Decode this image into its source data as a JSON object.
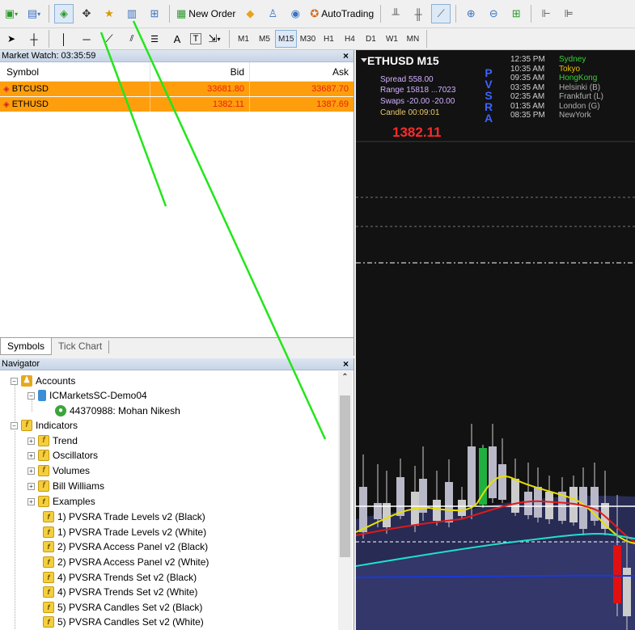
{
  "toolbar": {
    "new_order": "New Order",
    "auto_trading": "AutoTrading",
    "timeframes": [
      "M1",
      "M5",
      "M15",
      "M30",
      "H1",
      "H4",
      "D1",
      "W1",
      "MN"
    ],
    "active_timeframe": "M15",
    "text_tool": "A"
  },
  "market_watch": {
    "title": "Market Watch: 03:35:59",
    "close": "×",
    "col_symbol": "Symbol",
    "col_bid": "Bid",
    "col_ask": "Ask",
    "rows": [
      {
        "symbol": "BTCUSD",
        "bid": "33681.80",
        "ask": "33687.70"
      },
      {
        "symbol": "ETHUSD",
        "bid": "1382.11",
        "ask": "1387.69"
      }
    ],
    "tab_symbols": "Symbols",
    "tab_tick": "Tick Chart"
  },
  "navigator": {
    "title": "Navigator",
    "close": "×",
    "accounts": "Accounts",
    "server": "ICMarketsSC-Demo04",
    "account": "44370988: Mohan Nikesh",
    "indicators": "Indicators",
    "folders": [
      "Trend",
      "Oscillators",
      "Volumes",
      "Bill Williams",
      "Examples"
    ],
    "items": [
      "1) PVSRA Trade Levels v2 (Black)",
      "1) PVSRA Trade Levels v2 (White)",
      "2) PVSRA Access Panel v2 (Black)",
      "2) PVSRA Access Panel v2 (White)",
      "4) PVSRA Trends Set v2 (Black)",
      "4) PVSRA Trends Set v2 (White)",
      "5) PVSRA Candles Set v2 (Black)",
      "5) PVSRA Candles Set v2 (White)"
    ]
  },
  "chart": {
    "title": "ETHUSD  M15",
    "spread": "Spread 558.00",
    "range": "Range  15818  ...7023",
    "swaps": "Swaps  -20.00  -20.00",
    "candle": "Candle  00:09:01",
    "price": "1382.11",
    "pvsra": [
      "P",
      "V",
      "S",
      "R",
      "A"
    ],
    "sessions": [
      {
        "time": "12:35 PM",
        "name": "Sydney",
        "color": "#3ad03a"
      },
      {
        "time": "10:35 AM",
        "name": "Tokyo",
        "color": "#e6c200"
      },
      {
        "time": "09:35 AM",
        "name": "HongKong",
        "color": "#3ad03a"
      },
      {
        "time": "03:35 AM",
        "name": "Helsinki (B)",
        "color": "#b0b0b0"
      },
      {
        "time": "02:35 AM",
        "name": "Frankfurt (L)",
        "color": "#b0b0b0"
      },
      {
        "time": "01:35 AM",
        "name": "London  (G)",
        "color": "#b0b0b0"
      },
      {
        "time": "08:35 PM",
        "name": "NewYork",
        "color": "#b0b0b0"
      }
    ]
  },
  "colors": {
    "highlight_row": "#ff9e0d",
    "price_text": "#e8200a",
    "annotation_arrow": "#22e61a"
  }
}
